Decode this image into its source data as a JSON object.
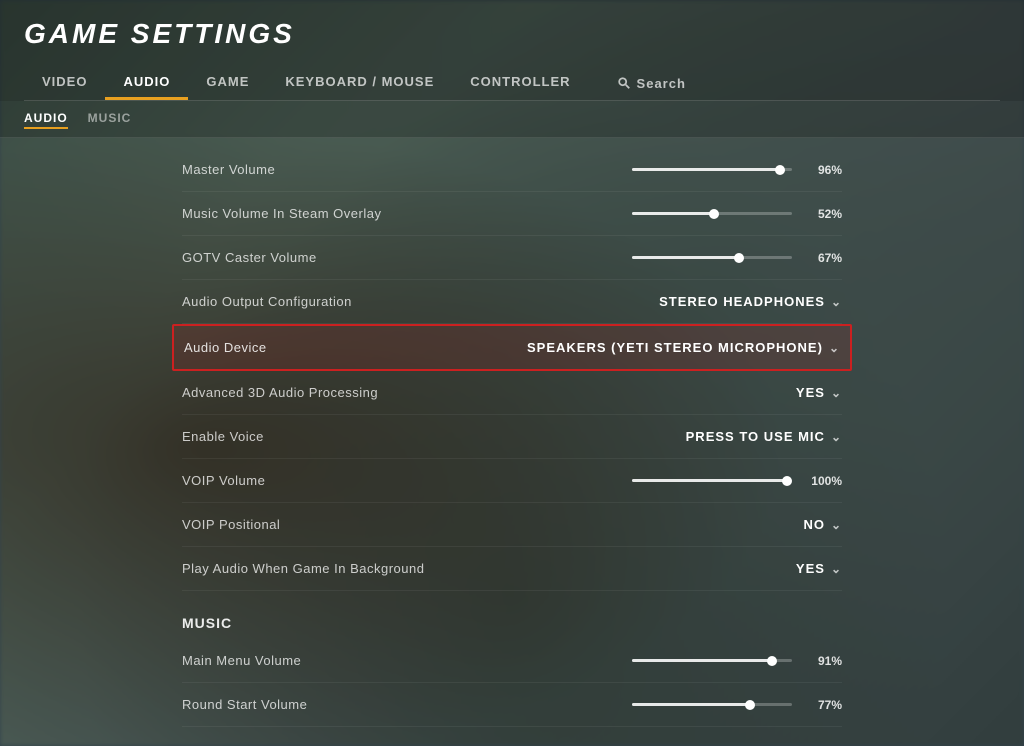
{
  "page": {
    "title": "GAME SETTINGS"
  },
  "nav": {
    "tabs": [
      {
        "id": "video",
        "label": "Video",
        "active": false
      },
      {
        "id": "audio",
        "label": "Audio",
        "active": true
      },
      {
        "id": "game",
        "label": "Game",
        "active": false
      },
      {
        "id": "keyboard-mouse",
        "label": "Keyboard / Mouse",
        "active": false
      },
      {
        "id": "controller",
        "label": "Controller",
        "active": false
      }
    ],
    "search_label": "Search"
  },
  "sub_tabs": [
    {
      "id": "audio",
      "label": "Audio",
      "active": true
    },
    {
      "id": "music",
      "label": "Music",
      "active": false
    }
  ],
  "settings": {
    "audio_section_label": "Music",
    "rows": [
      {
        "id": "master-volume",
        "label": "Master Volume",
        "type": "slider",
        "value": 96,
        "pct": "96%",
        "fill_width": 148
      },
      {
        "id": "music-volume-steam",
        "label": "Music Volume In Steam Overlay",
        "type": "slider",
        "value": 52,
        "pct": "52%",
        "fill_width": 82
      },
      {
        "id": "gotv-caster",
        "label": "GOTV Caster Volume",
        "type": "slider",
        "value": 67,
        "pct": "67%",
        "fill_width": 107
      },
      {
        "id": "audio-output",
        "label": "Audio Output Configuration",
        "type": "dropdown",
        "value": "STEREO HEADPHONES",
        "highlighted": false
      },
      {
        "id": "audio-device",
        "label": "Audio Device",
        "type": "dropdown",
        "value": "SPEAKERS (YETI STEREO MICROPHONE)",
        "highlighted": true
      },
      {
        "id": "3d-audio",
        "label": "Advanced 3D Audio Processing",
        "type": "dropdown",
        "value": "YES",
        "highlighted": false
      },
      {
        "id": "enable-voice",
        "label": "Enable Voice",
        "type": "dropdown",
        "value": "PRESS TO USE MIC",
        "highlighted": false
      },
      {
        "id": "voip-volume",
        "label": "VOIP Volume",
        "type": "slider",
        "value": 100,
        "pct": "100%",
        "fill_width": 155
      },
      {
        "id": "voip-positional",
        "label": "VOIP Positional",
        "type": "dropdown",
        "value": "NO",
        "highlighted": false
      },
      {
        "id": "play-audio-background",
        "label": "Play Audio When Game In Background",
        "type": "dropdown",
        "value": "YES",
        "highlighted": false
      }
    ],
    "music_rows": [
      {
        "id": "main-menu-volume",
        "label": "Main Menu Volume",
        "type": "slider",
        "value": 91,
        "pct": "91%",
        "fill_width": 140
      },
      {
        "id": "round-start-volume",
        "label": "Round Start Volume",
        "type": "slider",
        "value": 77,
        "pct": "77%",
        "fill_width": 118
      }
    ]
  },
  "icons": {
    "search": "&#128269;",
    "chevron_down": "&#8964;"
  }
}
